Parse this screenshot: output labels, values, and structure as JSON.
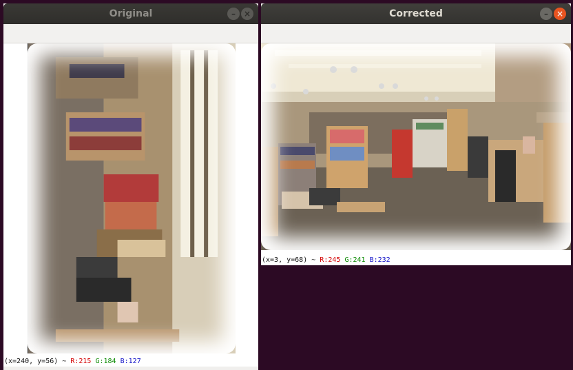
{
  "windows": {
    "original": {
      "title": "Original",
      "status": {
        "prefix": "(x=240, y=56) ~ ",
        "r": "R:215",
        "g": "G:184",
        "b": "B:127"
      },
      "image_rotation": "90deg"
    },
    "corrected": {
      "title": "Corrected",
      "status": {
        "prefix": "(x=3, y=68) ~ ",
        "r": "R:245",
        "g": "G:241",
        "b": "B:232"
      }
    }
  },
  "icons": {
    "minimize": "minimize-icon",
    "close": "close-icon"
  },
  "colors": {
    "desktop": "#2c0a24",
    "titlebar": "#3a3935",
    "close_active": "#e95420",
    "status_r": "#d40000",
    "status_g": "#0a8a00",
    "status_b": "#1010c8"
  }
}
